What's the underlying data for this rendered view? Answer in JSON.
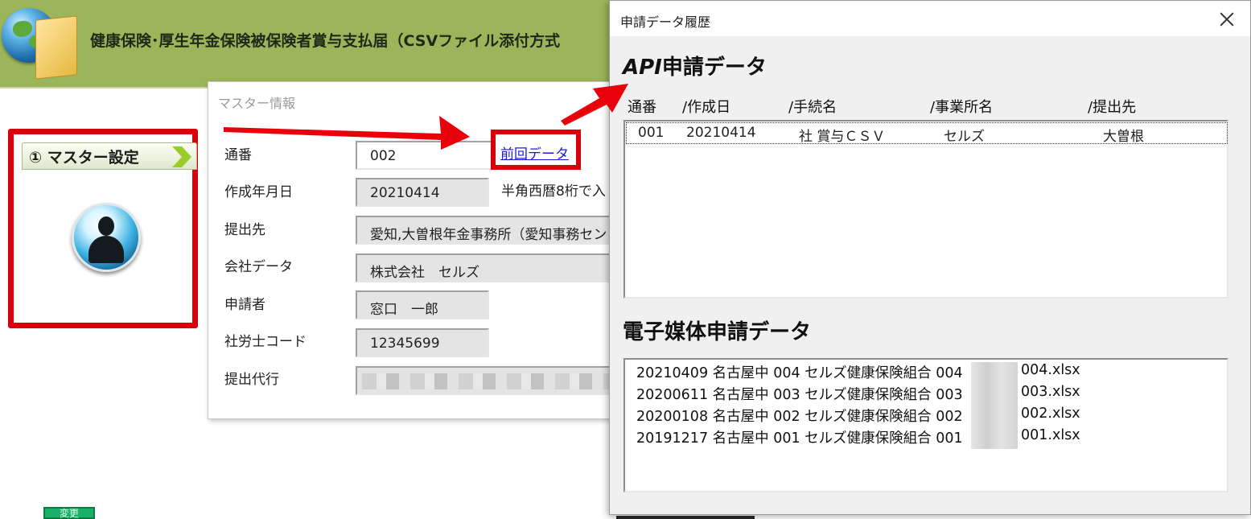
{
  "app": {
    "title": "健康保険･厚生年金保険被保険者賞与支払届（CSVファイル添付方式"
  },
  "step": {
    "label": "① マスター設定",
    "highlight_color": "#d9000a"
  },
  "footer_fragment": "変更",
  "master": {
    "title": "マスター情報",
    "prev_link": "前回データ",
    "fields": [
      {
        "label": "通番",
        "value": "002"
      },
      {
        "label": "作成年月日",
        "value": "20210414"
      },
      {
        "label": "提出先",
        "value": "愛知,大曽根年金事務所（愛知事務セン"
      },
      {
        "label": "会社データ",
        "value": "株式会社　セルズ"
      },
      {
        "label": "申請者",
        "value": "窓口　一郎"
      },
      {
        "label": "社労士コード",
        "value": "12345699"
      },
      {
        "label": "提出代行",
        "value": ""
      }
    ],
    "date_note": "半角西暦8桁で入"
  },
  "history": {
    "window_title": "申請データ履歴",
    "api_section": {
      "heading_prefix": "API",
      "heading_suffix": "申請データ",
      "columns": [
        "通番",
        "/作成日",
        "/手続名",
        "/事業所名",
        "/提出先"
      ],
      "rows": [
        {
          "no": "001",
          "date": "20210414",
          "procedure": "社 賞与ＣＳＶ",
          "office": "セルズ",
          "destination": "大曽根"
        }
      ]
    },
    "media_section": {
      "heading": "電子媒体申請データ",
      "files": [
        {
          "prefix": "20210409 名古屋中 004 セルズ健康保険組合 004",
          "suffix": "004.xlsx"
        },
        {
          "prefix": "20200611 名古屋中 003 セルズ健康保険組合 003",
          "suffix": "003.xlsx"
        },
        {
          "prefix": "20200108 名古屋中 002 セルズ健康保険組合 002",
          "suffix": "002.xlsx"
        },
        {
          "prefix": "20191217 名古屋中 001 セルズ健康保険組合 001",
          "suffix": "001.xlsx"
        }
      ]
    }
  },
  "colors": {
    "header_green": "#9bb65a",
    "highlight_red": "#d9000a",
    "link_blue": "#1a1ae0"
  }
}
